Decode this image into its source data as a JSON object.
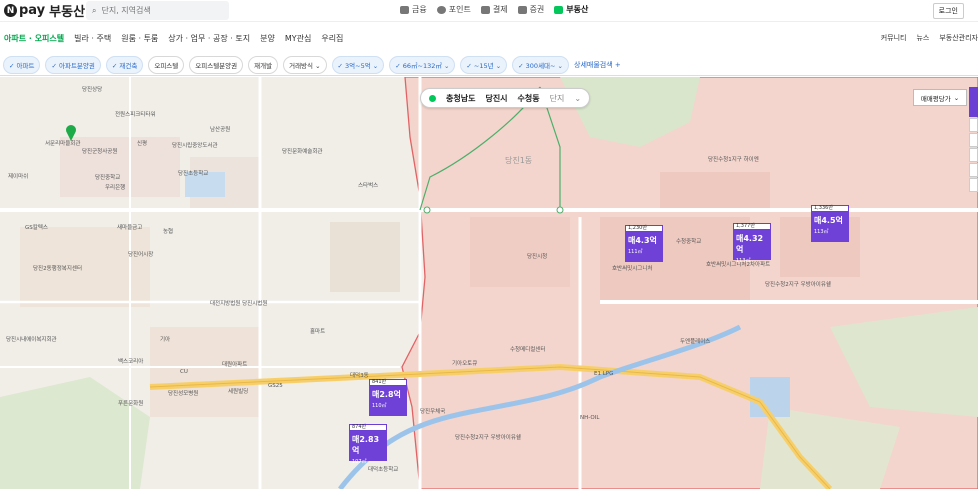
{
  "brand": {
    "logo_letter": "N",
    "pay": "pay",
    "name": "부동산"
  },
  "search": {
    "placeholder": "단지, 지역검색"
  },
  "services": [
    {
      "label": "금융",
      "active": false
    },
    {
      "label": "포인트",
      "active": false
    },
    {
      "label": "결제",
      "active": false
    },
    {
      "label": "증권",
      "active": false
    },
    {
      "label": "부동산",
      "active": true
    }
  ],
  "login_label": "로그인",
  "nav": {
    "tabs": [
      "아파트 · 오피스텔",
      "빌라 · 주택",
      "원룸 · 투룸",
      "상가 · 업무 · 공장 · 토지",
      "분양",
      "MY관심",
      "우리집"
    ],
    "right": [
      "커뮤니티",
      "뉴스",
      "부동산관리자"
    ]
  },
  "filters": {
    "chips": [
      {
        "label": "아파트",
        "selected": true,
        "dropdown": false
      },
      {
        "label": "아파트분양권",
        "selected": true,
        "dropdown": false
      },
      {
        "label": "재건축",
        "selected": true,
        "dropdown": false
      },
      {
        "label": "오피스텔",
        "selected": false,
        "dropdown": false
      },
      {
        "label": "오피스텔분양권",
        "selected": false,
        "dropdown": false
      },
      {
        "label": "재개발",
        "selected": false,
        "dropdown": false
      },
      {
        "label": "거래방식",
        "selected": false,
        "dropdown": true
      },
      {
        "label": "3억~5억",
        "selected": true,
        "dropdown": true
      },
      {
        "label": "66㎡~132㎡",
        "selected": true,
        "dropdown": true
      },
      {
        "label": "~15년",
        "selected": true,
        "dropdown": true
      },
      {
        "label": "300세대~",
        "selected": true,
        "dropdown": true
      }
    ],
    "more_label": "상세매물검색 +"
  },
  "location": {
    "province": "충청남도",
    "city": "당진시",
    "dong": "수청동",
    "complex": "단지"
  },
  "price_type_label": "매매평당가",
  "markers": [
    {
      "count": "1,230만",
      "price": "매4.3억",
      "area": "111㎡"
    },
    {
      "count": "1,377만",
      "price": "매4.32억",
      "area": "113㎡"
    },
    {
      "count": "1,336만",
      "price": "매4.5억",
      "area": "113㎡"
    },
    {
      "count": "841만",
      "price": "매2.8억",
      "area": "110㎡"
    },
    {
      "count": "874만",
      "price": "매2.83억",
      "area": "107㎡"
    }
  ],
  "map_labels": {
    "dong": "당진1동",
    "places": [
      "당진상당",
      "전원스피크티타워",
      "남산공원",
      "서문리마을회관",
      "당진군청사공원",
      "제이마쉬",
      "신평",
      "당진시립중앙도서관",
      "당진중학교",
      "우리은행",
      "당진초등학교",
      "새마을금고",
      "농협",
      "GS칼텍스",
      "당진문화예술회관",
      "당진시청",
      "당진2동행정복지센터",
      "당진어시장",
      "대전지방법원 당진시법원",
      "당진시내에이복지회관",
      "백스코리아",
      "기아",
      "CU",
      "대원아파트",
      "세원빌딩",
      "GS25",
      "푸른문화원",
      "대덕3동",
      "당진성모병원",
      "당진우체국",
      "홀마트",
      "당진수청1지구 하이엔",
      "수청중학교",
      "호반써밋시그니처",
      "호반써밋시그니처2차아파트",
      "당진수청2지구 우방아이유쉘",
      "두엔플레이스",
      "수청메디컬센터",
      "기아오토큐",
      "E1 LPG",
      "NH-OIL",
      "당진수청2지구 우방아이유쉘",
      "대덕초등학교",
      "당진우체국",
      "스타벅스",
      "빽다방",
      "신협",
      "대덕초등학교"
    ]
  },
  "colors": {
    "accent": "#03c75a",
    "marker": "#7041d6",
    "filter_selected": "#2a6ac8",
    "boundary": "#e0585a"
  }
}
